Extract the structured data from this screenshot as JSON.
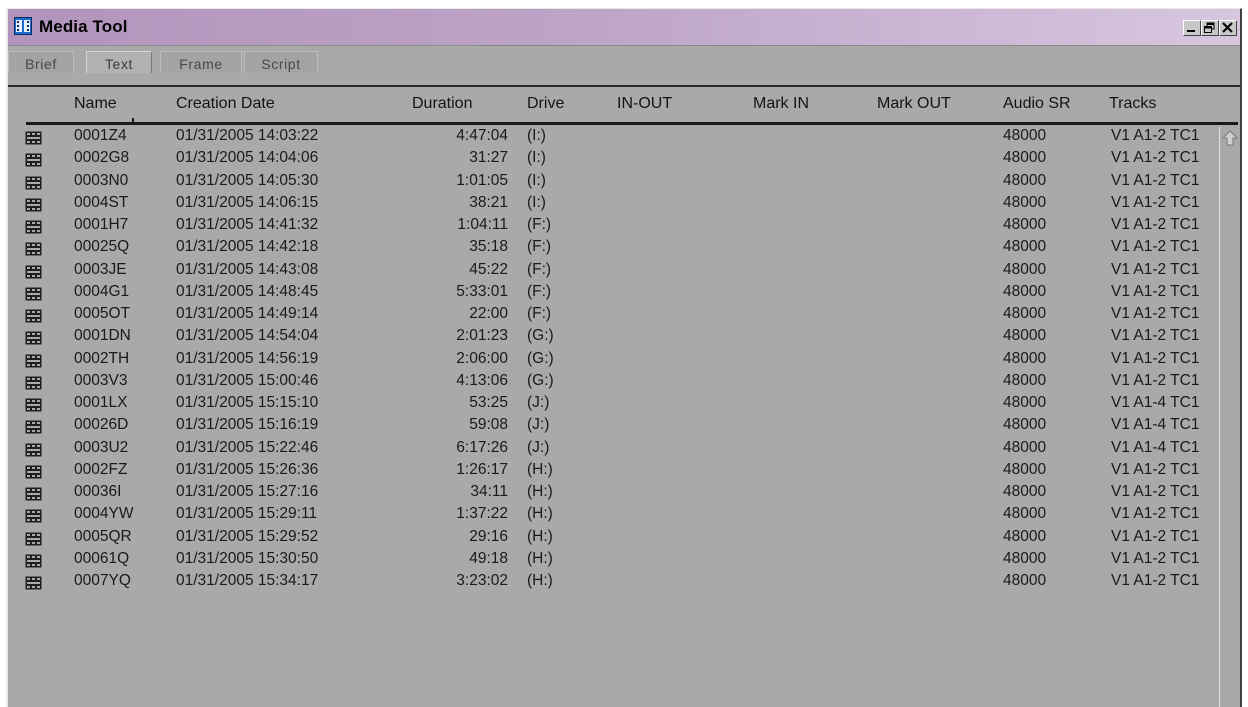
{
  "window": {
    "title": "Media Tool",
    "icon": "media-tool-icon",
    "controls": [
      "minimize-icon",
      "restore-icon",
      "close-icon"
    ]
  },
  "tabs": [
    {
      "label": "Brief",
      "active": false
    },
    {
      "label": "Text",
      "active": true
    },
    {
      "label": "Frame",
      "active": false
    },
    {
      "label": "Script",
      "active": false
    }
  ],
  "columns": {
    "name": "Name",
    "creation_date": "Creation Date",
    "duration": "Duration",
    "drive": "Drive",
    "in_out": "IN-OUT",
    "mark_in": "Mark IN",
    "mark_out": "Mark OUT",
    "audio_sr": "Audio SR",
    "tracks": "Tracks"
  },
  "rows": [
    {
      "name": "0001Z4",
      "date": "01/31/2005 14:03:22",
      "duration": "4:47:04",
      "drive": "(I:)",
      "audio_sr": "48000",
      "tracks": "V1 A1-2 TC1"
    },
    {
      "name": "0002G8",
      "date": "01/31/2005 14:04:06",
      "duration": "31:27",
      "drive": "(I:)",
      "audio_sr": "48000",
      "tracks": "V1 A1-2 TC1"
    },
    {
      "name": "0003N0",
      "date": "01/31/2005 14:05:30",
      "duration": "1:01:05",
      "drive": "(I:)",
      "audio_sr": "48000",
      "tracks": "V1 A1-2 TC1"
    },
    {
      "name": "0004ST",
      "date": "01/31/2005 14:06:15",
      "duration": "38:21",
      "drive": "(I:)",
      "audio_sr": "48000",
      "tracks": "V1 A1-2 TC1"
    },
    {
      "name": "0001H7",
      "date": "01/31/2005 14:41:32",
      "duration": "1:04:11",
      "drive": "(F:)",
      "audio_sr": "48000",
      "tracks": "V1 A1-2 TC1"
    },
    {
      "name": "00025Q",
      "date": "01/31/2005 14:42:18",
      "duration": "35:18",
      "drive": "(F:)",
      "audio_sr": "48000",
      "tracks": "V1 A1-2 TC1"
    },
    {
      "name": "0003JE",
      "date": "01/31/2005 14:43:08",
      "duration": "45:22",
      "drive": "(F:)",
      "audio_sr": "48000",
      "tracks": "V1 A1-2 TC1"
    },
    {
      "name": "0004G1",
      "date": "01/31/2005 14:48:45",
      "duration": "5:33:01",
      "drive": "(F:)",
      "audio_sr": "48000",
      "tracks": "V1 A1-2 TC1"
    },
    {
      "name": "0005OT",
      "date": "01/31/2005 14:49:14",
      "duration": "22:00",
      "drive": "(F:)",
      "audio_sr": "48000",
      "tracks": "V1 A1-2 TC1"
    },
    {
      "name": "0001DN",
      "date": "01/31/2005 14:54:04",
      "duration": "2:01:23",
      "drive": "(G:)",
      "audio_sr": "48000",
      "tracks": "V1 A1-2 TC1"
    },
    {
      "name": "0002TH",
      "date": "01/31/2005 14:56:19",
      "duration": "2:06:00",
      "drive": "(G:)",
      "audio_sr": "48000",
      "tracks": "V1 A1-2 TC1"
    },
    {
      "name": "0003V3",
      "date": "01/31/2005 15:00:46",
      "duration": "4:13:06",
      "drive": "(G:)",
      "audio_sr": "48000",
      "tracks": "V1 A1-2 TC1"
    },
    {
      "name": "0001LX",
      "date": "01/31/2005 15:15:10",
      "duration": "53:25",
      "drive": "(J:)",
      "audio_sr": "48000",
      "tracks": "V1 A1-4 TC1"
    },
    {
      "name": "00026D",
      "date": "01/31/2005 15:16:19",
      "duration": "59:08",
      "drive": "(J:)",
      "audio_sr": "48000",
      "tracks": "V1 A1-4 TC1"
    },
    {
      "name": "0003U2",
      "date": "01/31/2005 15:22:46",
      "duration": "6:17:26",
      "drive": "(J:)",
      "audio_sr": "48000",
      "tracks": "V1 A1-4 TC1"
    },
    {
      "name": "0002FZ",
      "date": "01/31/2005 15:26:36",
      "duration": "1:26:17",
      "drive": "(H:)",
      "audio_sr": "48000",
      "tracks": "V1 A1-2 TC1"
    },
    {
      "name": "00036I",
      "date": "01/31/2005 15:27:16",
      "duration": "34:11",
      "drive": "(H:)",
      "audio_sr": "48000",
      "tracks": "V1 A1-2 TC1"
    },
    {
      "name": "0004YW",
      "date": "01/31/2005 15:29:11",
      "duration": "1:37:22",
      "drive": "(H:)",
      "audio_sr": "48000",
      "tracks": "V1 A1-2 TC1"
    },
    {
      "name": "0005QR",
      "date": "01/31/2005 15:29:52",
      "duration": "29:16",
      "drive": "(H:)",
      "audio_sr": "48000",
      "tracks": "V1 A1-2 TC1"
    },
    {
      "name": "00061Q",
      "date": "01/31/2005 15:30:50",
      "duration": "49:18",
      "drive": "(H:)",
      "audio_sr": "48000",
      "tracks": "V1 A1-2 TC1"
    },
    {
      "name": "0007YQ",
      "date": "01/31/2005 15:34:17",
      "duration": "3:23:02",
      "drive": "(H:)",
      "audio_sr": "48000",
      "tracks": "V1 A1-2 TC1"
    }
  ],
  "row_icon": "film-clip-icon",
  "scrollbar": {
    "up_icon": "scroll-up-arrow-icon"
  }
}
